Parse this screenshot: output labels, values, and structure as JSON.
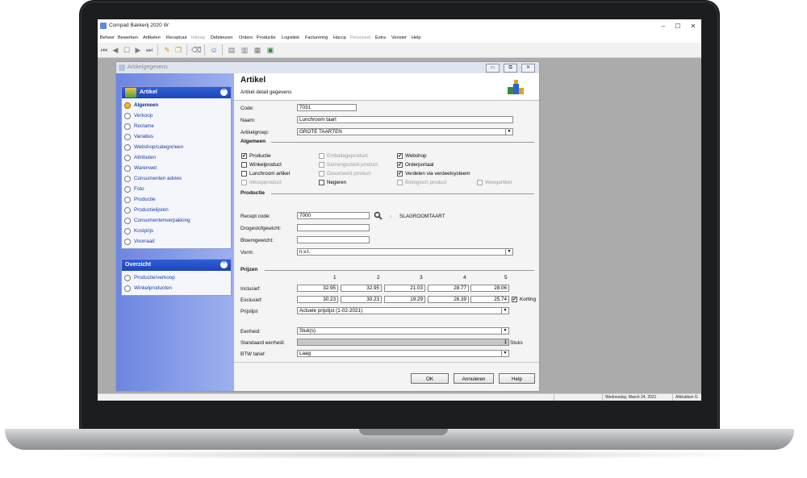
{
  "app": {
    "title": "Compad Bakkerij 2020 W"
  },
  "window_controls": {
    "minimize": "–",
    "maximize": "☐",
    "close": "✕"
  },
  "menu": [
    {
      "label": "Beheer",
      "enabled": true
    },
    {
      "label": "Bewerken",
      "enabled": true
    },
    {
      "label": "Artikelen",
      "enabled": true
    },
    {
      "label": "Receptuur",
      "enabled": true
    },
    {
      "label": "Inkoop",
      "enabled": false
    },
    {
      "label": "Debiteuren",
      "enabled": true
    },
    {
      "label": "Orders",
      "enabled": true
    },
    {
      "label": "Productie",
      "enabled": true
    },
    {
      "label": "Logistiek",
      "enabled": true
    },
    {
      "label": "Facturering",
      "enabled": true
    },
    {
      "label": "Haccp",
      "enabled": true
    },
    {
      "label": "Personeel",
      "enabled": false
    },
    {
      "label": "Extra",
      "enabled": true
    },
    {
      "label": "Venster",
      "enabled": true
    },
    {
      "label": "Help",
      "enabled": true
    }
  ],
  "toolbar": {
    "icons": [
      "first-record-icon",
      "previous-record-icon",
      "search-record-icon",
      "next-record-icon",
      "last-record-icon",
      "edit-icon",
      "copy-icon",
      "delete-icon",
      "users-icon",
      "document-icon",
      "report-icon",
      "calculator-icon",
      "export-icon"
    ],
    "glyphs": {
      "first": "⏮",
      "prev": "◀",
      "search": "☐",
      "next": "▶",
      "last": "⏭",
      "edit": "✎",
      "copy": "❐",
      "delete": "⌫",
      "users": "☺",
      "doc": "▤",
      "report": "▥",
      "calc": "▦",
      "export": "▣"
    }
  },
  "child_window": {
    "title": "Artikelgegevens",
    "buttons": {
      "minimize": "▭",
      "restore": "⧉",
      "close": "✕"
    }
  },
  "sidebar": {
    "artikel": {
      "title": "Artikel",
      "chevron": "⌃",
      "items": [
        "Algemeen",
        "Verkoop",
        "Reclame",
        "Variaties",
        "Webshop/categorieen",
        "Attributen",
        "Warenwet",
        "Consumenten advies",
        "Foto",
        "Productie",
        "Productielijsten",
        "Consumentenverpakking",
        "Kostprijs",
        "Voorraad"
      ],
      "active": "Algemeen"
    },
    "overzicht": {
      "title": "Overzicht",
      "chevron": "⌃",
      "items": [
        "Productie/verkoop",
        "Winkelproducten"
      ]
    }
  },
  "form": {
    "title": "Artikel",
    "subtitle": "Artikel detail gegevens",
    "code_label": "Code:",
    "code": "7031",
    "naam_label": "Naam:",
    "naam": "Lunchroom taart",
    "artikelgroep_label": "Artikelgroep:",
    "artikelgroep": "GROTE TAARTEN",
    "dropdown_arrow": "▼",
    "algemeen_title": "Algemeen",
    "checkboxes": [
      {
        "label": "Productie",
        "checked": true,
        "enabled": true
      },
      {
        "label": "Winkelproduct",
        "checked": false,
        "enabled": true
      },
      {
        "label": "Lunchroom artikel",
        "checked": false,
        "enabled": true
      },
      {
        "label": "Inkoopproduct",
        "checked": false,
        "enabled": false
      },
      {
        "label": "Emballageproduct",
        "checked": false,
        "enabled": false
      },
      {
        "label": "Samengesteld product",
        "checked": false,
        "enabled": false
      },
      {
        "label": "Gesorteerd product",
        "checked": false,
        "enabled": false
      },
      {
        "label": "Negeren",
        "checked": false,
        "enabled": true
      },
      {
        "label": "Webshop",
        "checked": true,
        "enabled": true
      },
      {
        "label": "Orderportaal",
        "checked": true,
        "enabled": true
      },
      {
        "label": "Verdelen via verdeelsysteem",
        "checked": true,
        "enabled": true
      },
      {
        "label": "Biologisch product",
        "checked": false,
        "enabled": false
      },
      {
        "label": "Weegartikel",
        "checked": false,
        "enabled": false
      }
    ],
    "check_mark": "✔",
    "productie_title": "Productie",
    "recept_code_label": "Recept code:",
    "recept_code": "7000",
    "recept_name": "SLAGROOMTAART",
    "drogestofgewicht_label": "Drogestofgewicht:",
    "bloemgewicht_label": "Bloemgewicht:",
    "vorm_label": "Vorm:",
    "vorm": "n.v.t.",
    "prijzen_title": "Prijzen",
    "price_columns": [
      "1",
      "2",
      "3",
      "4",
      "5"
    ],
    "inclusief_label": "Inclusief:",
    "inclusief": [
      "32.95",
      "32.95",
      "21.03",
      "28.77",
      "28.06"
    ],
    "exclusief_label": "Exclusief:",
    "exclusief": [
      "30.23",
      "30.23",
      "19.29",
      "26.39",
      "25.74"
    ],
    "korting_label": "Korting",
    "korting_checked": true,
    "prijslijst_label": "Prijslijst",
    "prijslijst": "Actuele prijslijst (1-02-2021)",
    "eenheid_label": "Eenheid:",
    "eenheid": "Stuk(s)",
    "standaard_eenheid_label": "Standaard eenheid:",
    "standaard_eenheid_value": "1",
    "standaard_eenheid_unit": "Stuks",
    "btw_label": "BTW tarief",
    "btw": "Laag",
    "ok_button": "OK",
    "cancel_button": "Annuleren",
    "help_button": "Help"
  },
  "statusbar": {
    "date": "Wednesday, March 24, 2021",
    "user": "Afdrukken G"
  },
  "colors": {
    "sidebar_header": "#1d45b8",
    "sidebar_bg": "#8fa4ea",
    "active_radio": "#f2b632"
  }
}
